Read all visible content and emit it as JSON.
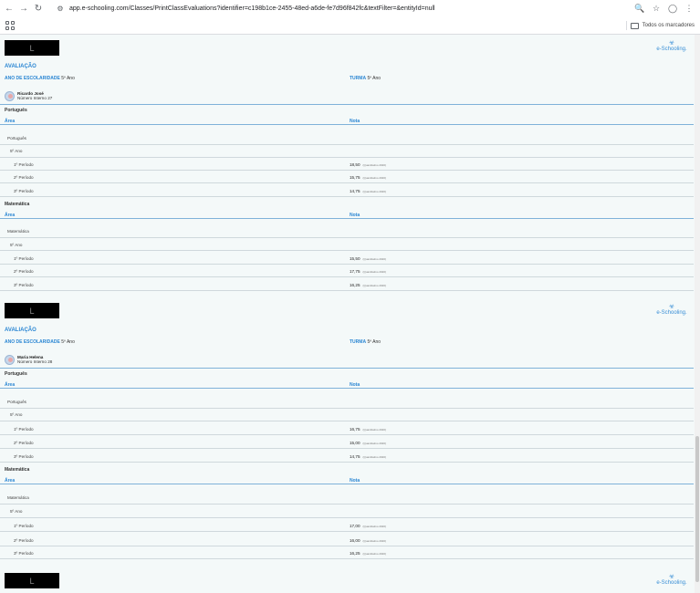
{
  "browser": {
    "url": "app.e-schooling.com/Classes/PrintClassEvaluations?identifier=c198b1ce-2455-48ed-a6de-fe7d96f842fc&textFilter=&entityId=null",
    "bookmarks_all": "Todos os marcadores"
  },
  "page": {
    "logo_text": "L",
    "brand": "e-Schooling.",
    "section_title": "AVALIAÇÃO",
    "grade_label": "ANO DE ESCOLARIDADE",
    "class_label": "TURMA",
    "col_area": "Área",
    "col_nota": "Nota"
  },
  "students": [
    {
      "grade_value": "5º Ano",
      "class_value": "5º Ano",
      "name": "Ricardo José",
      "number": "Número Interno 27",
      "subjects": [
        {
          "title": "Português",
          "area": "Português",
          "year": "5º Ano",
          "periods": [
            {
              "label": "1º Período",
              "grade": "18,50",
              "note": "(Quantitativo 2020)"
            },
            {
              "label": "2º Período",
              "grade": "15,75",
              "note": "(Quantitativo 2020)"
            },
            {
              "label": "3º Período",
              "grade": "14,75",
              "note": "(Quantitativo 2020)"
            }
          ]
        },
        {
          "title": "Matemática",
          "area": "Matemática",
          "year": "5º Ano",
          "periods": [
            {
              "label": "1º Período",
              "grade": "15,50",
              "note": "(Quantitativo 2020)"
            },
            {
              "label": "2º Período",
              "grade": "17,75",
              "note": "(Quantitativo 2020)"
            },
            {
              "label": "3º Período",
              "grade": "16,25",
              "note": "(Quantitativo 2020)"
            }
          ]
        }
      ]
    },
    {
      "grade_value": "5º Ano",
      "class_value": "5º Ano",
      "name": "Maria Helena",
      "number": "Número Interno 28",
      "subjects": [
        {
          "title": "Português",
          "area": "Português",
          "year": "5º Ano",
          "periods": [
            {
              "label": "1º Período",
              "grade": "16,75",
              "note": "(Quantitativo 2020)"
            },
            {
              "label": "2º Período",
              "grade": "15,00",
              "note": "(Quantitativo 2020)"
            },
            {
              "label": "3º Período",
              "grade": "14,75",
              "note": "(Quantitativo 2020)"
            }
          ]
        },
        {
          "title": "Matemática",
          "area": "Matemática",
          "year": "5º Ano",
          "periods": [
            {
              "label": "1º Período",
              "grade": "17,00",
              "note": "(Quantitativo 2020)"
            },
            {
              "label": "2º Período",
              "grade": "16,00",
              "note": "(Quantitativo 2020)"
            },
            {
              "label": "3º Período",
              "grade": "16,25",
              "note": "(Quantitativo 2020)"
            }
          ]
        }
      ]
    }
  ]
}
